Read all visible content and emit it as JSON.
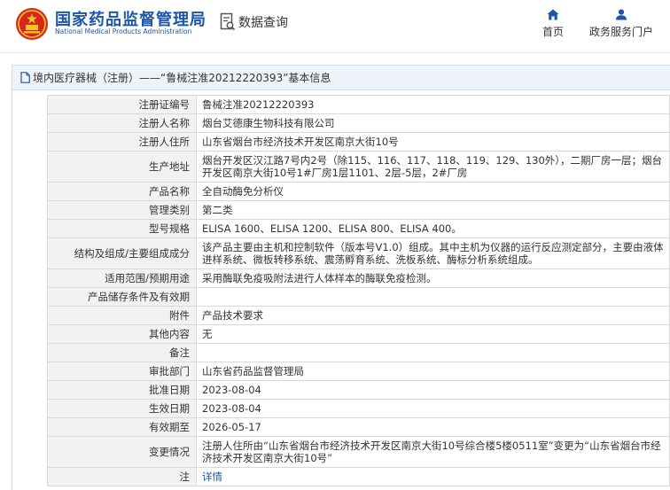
{
  "header": {
    "site_name_cn": "国家药品监督管理局",
    "site_name_en": "National Medical Products Administration",
    "page_title": "数据查询",
    "nav": [
      {
        "label": "首页",
        "icon": "home-icon"
      },
      {
        "label": "政务服务门户",
        "icon": "user-icon"
      }
    ]
  },
  "panel": {
    "title": "境内医疗器械（注册）——“鲁械注准20212220393”基本信息"
  },
  "rows": [
    {
      "label": "注册证编号",
      "value": "鲁械注准20212220393"
    },
    {
      "label": "注册人名称",
      "value": "烟台艾德康生物科技有限公司"
    },
    {
      "label": "注册人住所",
      "value": "山东省烟台市经济技术开发区南京大街10号"
    },
    {
      "label": "生产地址",
      "value": "烟台开发区汉江路7号内2号（除115、116、117、118、119、129、130外），二期厂房一层；烟台开发区南京大街10号1#厂房1层1101、2层-5层，2#厂房"
    },
    {
      "label": "产品名称",
      "value": "全自动酶免分析仪"
    },
    {
      "label": "管理类别",
      "value": "第二类"
    },
    {
      "label": "型号规格",
      "value": "ELISA 1600、ELISA 1200、ELISA 800、ELISA 400。"
    },
    {
      "label": "结构及组成/主要组成成分",
      "value": "该产品主要由主机和控制软件（版本号V1.0）组成。其中主机为仪器的运行反应测定部分，主要由液体进样系统、微板转移系统、震荡孵育系统、洗板系统、酶标分析系统组成。"
    },
    {
      "label": "适用范围/预期用途",
      "value": "采用酶联免疫吸附法进行人体样本的酶联免疫检测。"
    },
    {
      "label": "产品储存条件及有效期",
      "value": ""
    },
    {
      "label": "附件",
      "value": "产品技术要求"
    },
    {
      "label": "其他内容",
      "value": "无"
    },
    {
      "label": "备注",
      "value": ""
    },
    {
      "label": "审批部门",
      "value": "山东省药品监督管理局"
    },
    {
      "label": "批准日期",
      "value": "2023-08-04"
    },
    {
      "label": "生效日期",
      "value": "2023-08-04"
    },
    {
      "label": "有效期至",
      "value": "2026-05-17"
    },
    {
      "label": "变更情况",
      "value": "注册人住所由“山东省烟台市经济技术开发区南京大街10号综合楼5楼0511室”变更为“山东省烟台市经济技术开发区南京大街10号”"
    },
    {
      "label": "注",
      "value": "详情",
      "is_link": true
    }
  ],
  "colors": {
    "brand_blue": "#1e56a5",
    "emblem_red": "#d7261e",
    "emblem_gold": "#f3c623",
    "label_bg": "#f2f2f2",
    "panel_header_bg": "#eef3f9"
  }
}
